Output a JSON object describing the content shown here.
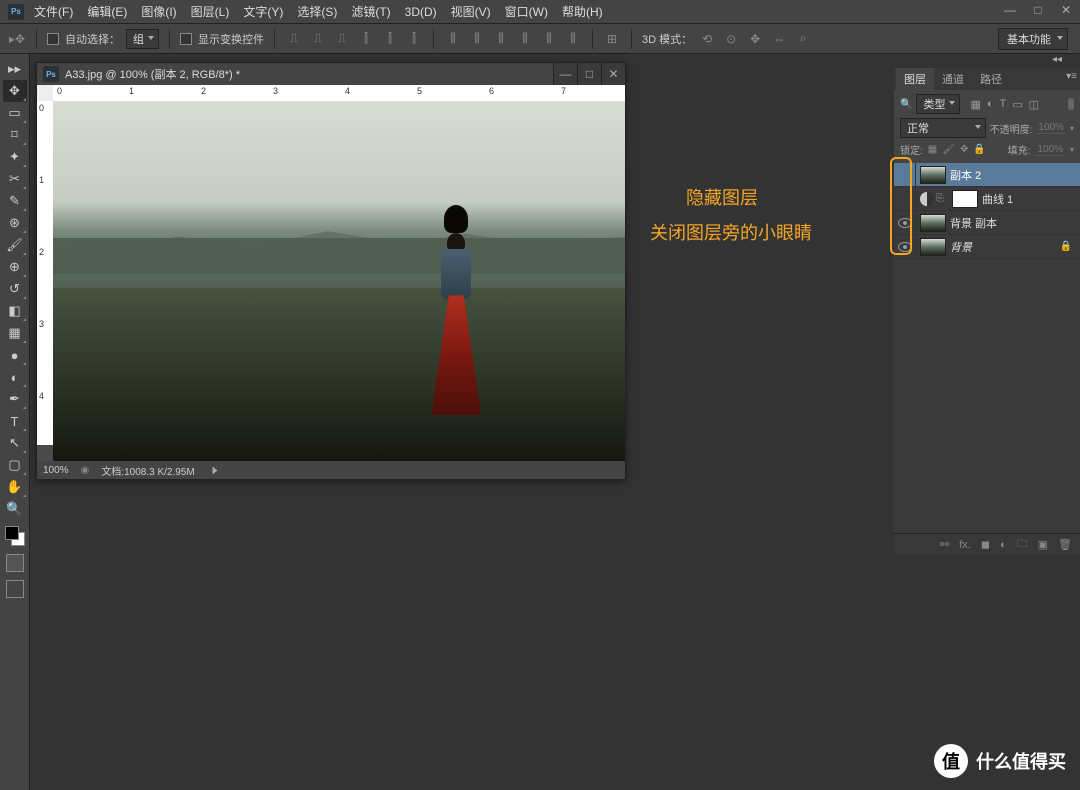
{
  "menu": {
    "logo": "Ps",
    "items": [
      "文件(F)",
      "编辑(E)",
      "图像(I)",
      "图层(L)",
      "文字(Y)",
      "选择(S)",
      "滤镜(T)",
      "3D(D)",
      "视图(V)",
      "窗口(W)",
      "帮助(H)"
    ]
  },
  "window_controls": {
    "min": "—",
    "max": "□",
    "close": "✕"
  },
  "options": {
    "auto_select": "自动选择：",
    "group": "组",
    "show_transform": "显示变换控件",
    "mode_3d": "3D 模式：",
    "workspace": "基本功能"
  },
  "document": {
    "title": "A33.jpg @ 100% (副本 2, RGB/8*) *",
    "zoom": "100%",
    "doc_info": "文档:1008.3 K/2.95M",
    "ruler_h": [
      "0",
      "1",
      "2",
      "3",
      "4",
      "5",
      "6",
      "7"
    ],
    "ruler_v": [
      "0",
      "1",
      "2",
      "3",
      "4"
    ]
  },
  "annotations": {
    "line1": "隐藏图层",
    "line2": "关闭图层旁的小眼睛"
  },
  "panels": {
    "tabs": [
      "图层",
      "通道",
      "路径"
    ],
    "filter_label": "类型",
    "blend_mode": "正常",
    "opacity_label": "不透明度:",
    "opacity_value": "100%",
    "lock_label": "锁定:",
    "fill_label": "填充:",
    "fill_value": "100%",
    "layers": [
      {
        "name": "副本 2",
        "visible": false,
        "type": "image",
        "active": true
      },
      {
        "name": "曲线 1",
        "visible": false,
        "type": "adjustment",
        "active": false
      },
      {
        "name": "背景 副本",
        "visible": true,
        "type": "image",
        "active": false
      },
      {
        "name": "背景",
        "visible": true,
        "type": "image",
        "active": false,
        "locked": true,
        "italic": true
      }
    ]
  },
  "watermark": {
    "badge": "值",
    "text": "什么值得买"
  }
}
